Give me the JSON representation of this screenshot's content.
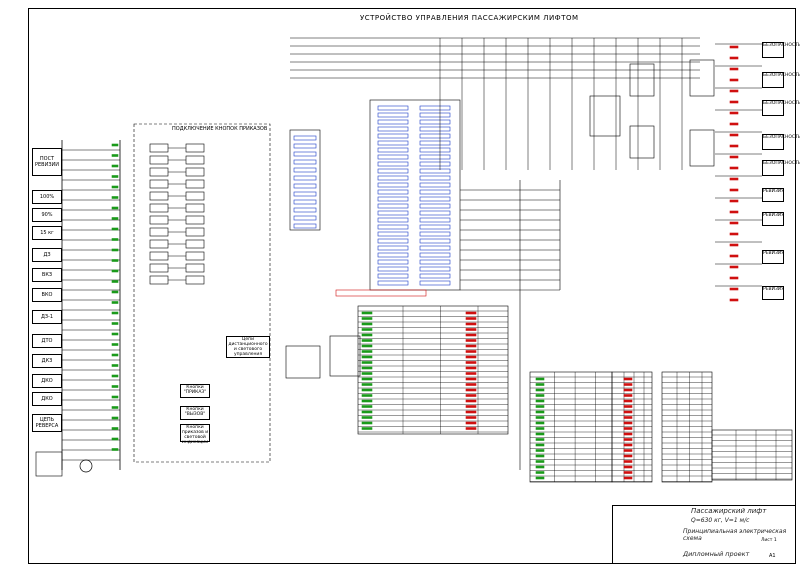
{
  "drawing": {
    "title": "УСТРОЙСТВО УПРАВЛЕНИЯ ПАССАЖИРСКИМ ЛИФТОМ",
    "push_button_section_title": "ПОДКЛЮЧЕНИЕ КНОПОК ПРИКАЗОВ",
    "side_labels": [
      "ПОСТ РЕВИЗИИ",
      "100%",
      "90%",
      "15 кг",
      "ДЗ",
      "ВКЗ",
      "ВКО",
      "ДЗ-1",
      "ДТО",
      "ДКЗ",
      "ДКО",
      "ДКО",
      "ЦЕПЬ РЕВЕРСА"
    ],
    "right_labels": [
      "БЕЗОПАСНОСТЬ",
      "БЕЗОПАСНОСТЬ",
      "БЕЗОПАСНОСТЬ",
      "БЕЗОПАСНОСТЬ",
      "БЕЗОПАСНОСТЬ",
      "РЕВИЗИЯ",
      "РЕВИЗИЯ",
      "РЕВИЗИЯ",
      "РЕВИЗИЯ"
    ],
    "notes": [
      "Цепи дистанционного и светового управления",
      "Кнопки \"ПРИКАЗ\"",
      "Кнопки \"ВЫЗОВ\"",
      "Кнопки приказов и световой индикации"
    ]
  },
  "title_block": {
    "product": "Пассажирский лифт",
    "spec": "Q=630 кг, V=1 м/с",
    "sheet_name": "Принципиальная электрическая схема",
    "doc_type": "Дипломный проект",
    "sheet_label": "Лист 1",
    "format": "А1"
  },
  "colors": {
    "line": "#000000",
    "label_green": "#1a9a1a",
    "relay_blue": "#1c3cc8",
    "marker_red": "#d01010",
    "relay_box": "#ffffff"
  }
}
